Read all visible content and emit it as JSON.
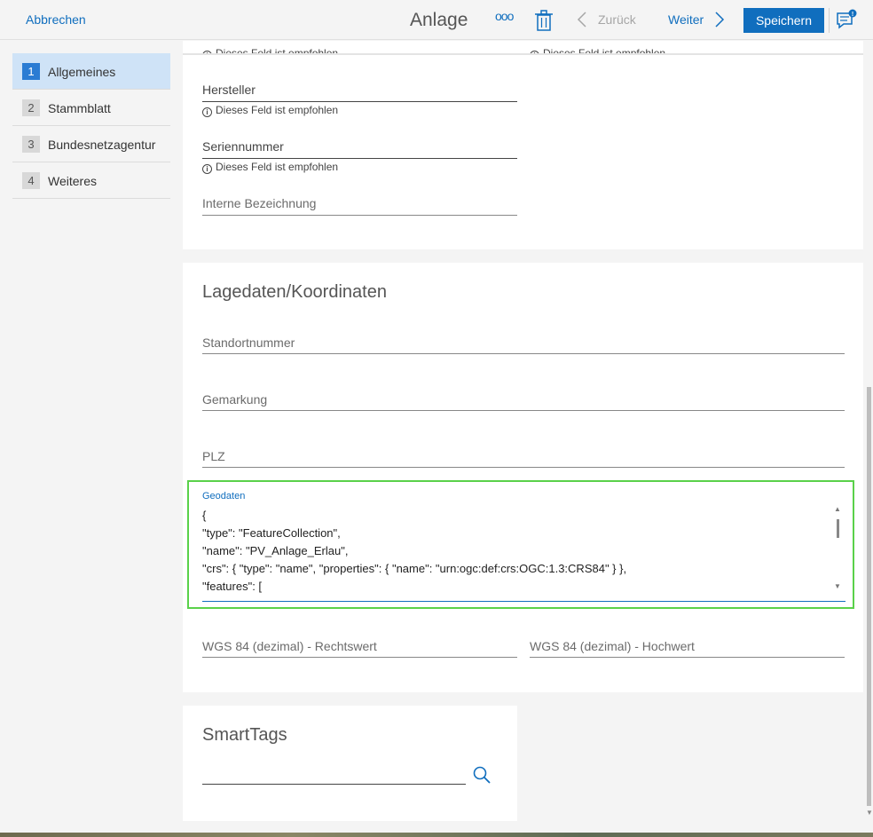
{
  "topbar": {
    "cancel_label": "Abbrechen",
    "title": "Anlage",
    "more_label": "ooo",
    "back_label": "Zurück",
    "next_label": "Weiter",
    "save_label": "Speichern",
    "accent_color": "#106ebe"
  },
  "nav": {
    "items": [
      {
        "number": "1",
        "label": "Allgemeines",
        "active": true
      },
      {
        "number": "2",
        "label": "Stammblatt",
        "active": false
      },
      {
        "number": "3",
        "label": "Bundesnetzagentur",
        "active": false
      },
      {
        "number": "4",
        "label": "Weiteres",
        "active": false
      }
    ]
  },
  "general": {
    "hint_text": "Dieses Feld ist empfohlen",
    "hersteller_label": "Hersteller",
    "seriennummer_label": "Seriennummer",
    "interne_bezeichnung_label": "Interne Bezeichnung"
  },
  "lage": {
    "title": "Lagedaten/Koordinaten",
    "standortnummer_label": "Standortnummer",
    "gemarkung_label": "Gemarkung",
    "plz_label": "PLZ",
    "geodaten_label": "Geodaten",
    "geodaten_lines": [
      "{",
      "\"type\": \"FeatureCollection\",",
      "\"name\": \"PV_Anlage_Erlau\",",
      "\"crs\": { \"type\": \"name\", \"properties\": { \"name\": \"urn:ogc:def:crs:OGC:1.3:CRS84\" } },",
      "\"features\": ["
    ],
    "rechtswert_label": "WGS 84 (dezimal) - Rechtswert",
    "hochwert_label": "WGS 84 (dezimal) - Hochwert"
  },
  "smarttags": {
    "title": "SmartTags"
  }
}
